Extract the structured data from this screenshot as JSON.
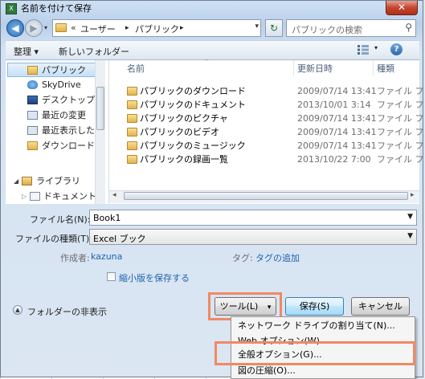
{
  "window": {
    "title": "名前を付けて保存",
    "close_glyph": "✕"
  },
  "nav": {
    "back_glyph": "◀",
    "forward_glyph": "▶",
    "breadcrumb": [
      "«",
      "ユーザー",
      "▸",
      "パブリック",
      "▸"
    ],
    "dropdown_glyph": "▾",
    "refresh_glyph": "↻",
    "search_placeholder": "パブリックの検索"
  },
  "toolbar": {
    "organize": "整理 ▾",
    "new_folder": "新しいフォルダー",
    "view_dropdown": "▾",
    "help": "?"
  },
  "nav_pane": {
    "items": [
      {
        "label": "パブリック",
        "icon": "folder-icon",
        "selected": true
      },
      {
        "label": "SkyDrive",
        "icon": "skydrive-icon"
      },
      {
        "label": "デスクトップ",
        "icon": "desktop-icon"
      },
      {
        "label": "最近の変更",
        "icon": "recent-changes-icon"
      },
      {
        "label": "最近表示した場所",
        "icon": "recent-places-icon"
      },
      {
        "label": "ダウンロード",
        "icon": "downloads-icon"
      },
      {
        "label": "ライブラリ",
        "icon": "libraries-icon"
      },
      {
        "label": "ドキュメント",
        "icon": "documents-icon"
      }
    ]
  },
  "file_list": {
    "columns": {
      "name": "名前",
      "date": "更新日時",
      "type": "種類"
    },
    "rows": [
      {
        "name": "パブリックのダウンロード",
        "date": "2009/07/14 13:41",
        "type": "ファイル フ"
      },
      {
        "name": "パブリックのドキュメント",
        "date": "2013/10/01 3:14",
        "type": "ファイル フ"
      },
      {
        "name": "パブリックのピクチャ",
        "date": "2009/07/14 13:41",
        "type": "ファイル フ"
      },
      {
        "name": "パブリックのビデオ",
        "date": "2009/07/14 13:41",
        "type": "ファイル フ"
      },
      {
        "name": "パブリックのミュージック",
        "date": "2009/07/14 13:41",
        "type": "ファイル フ"
      },
      {
        "name": "パブリックの録画一覧",
        "date": "2013/10/22 7:00",
        "type": "ファイル フ"
      }
    ]
  },
  "form": {
    "filename_label": "ファイル名(N):",
    "filename_value": "Book1",
    "filetype_label": "ファイルの種類(T):",
    "filetype_value": "Excel ブック",
    "author_label": "作成者:",
    "author_value": "kazuna",
    "tags_label": "タグ:",
    "tags_value": "タグの追加",
    "thumbnail_label": "縮小版を保存する"
  },
  "bottom": {
    "hide_folders": "フォルダーの非表示",
    "tools": "ツール(L)",
    "tools_arrow": "▾",
    "save": "保存(S)",
    "cancel": "キャンセル"
  },
  "tools_menu": {
    "items": [
      "ネットワーク ドライブの割り当て(N)...",
      "Web オプション(W)...",
      "全般オプション(G)...",
      "図の圧縮(O)..."
    ]
  },
  "colors": {
    "highlight": "#f08962",
    "selection": "#c6e0f7",
    "link": "#1f62b0"
  }
}
